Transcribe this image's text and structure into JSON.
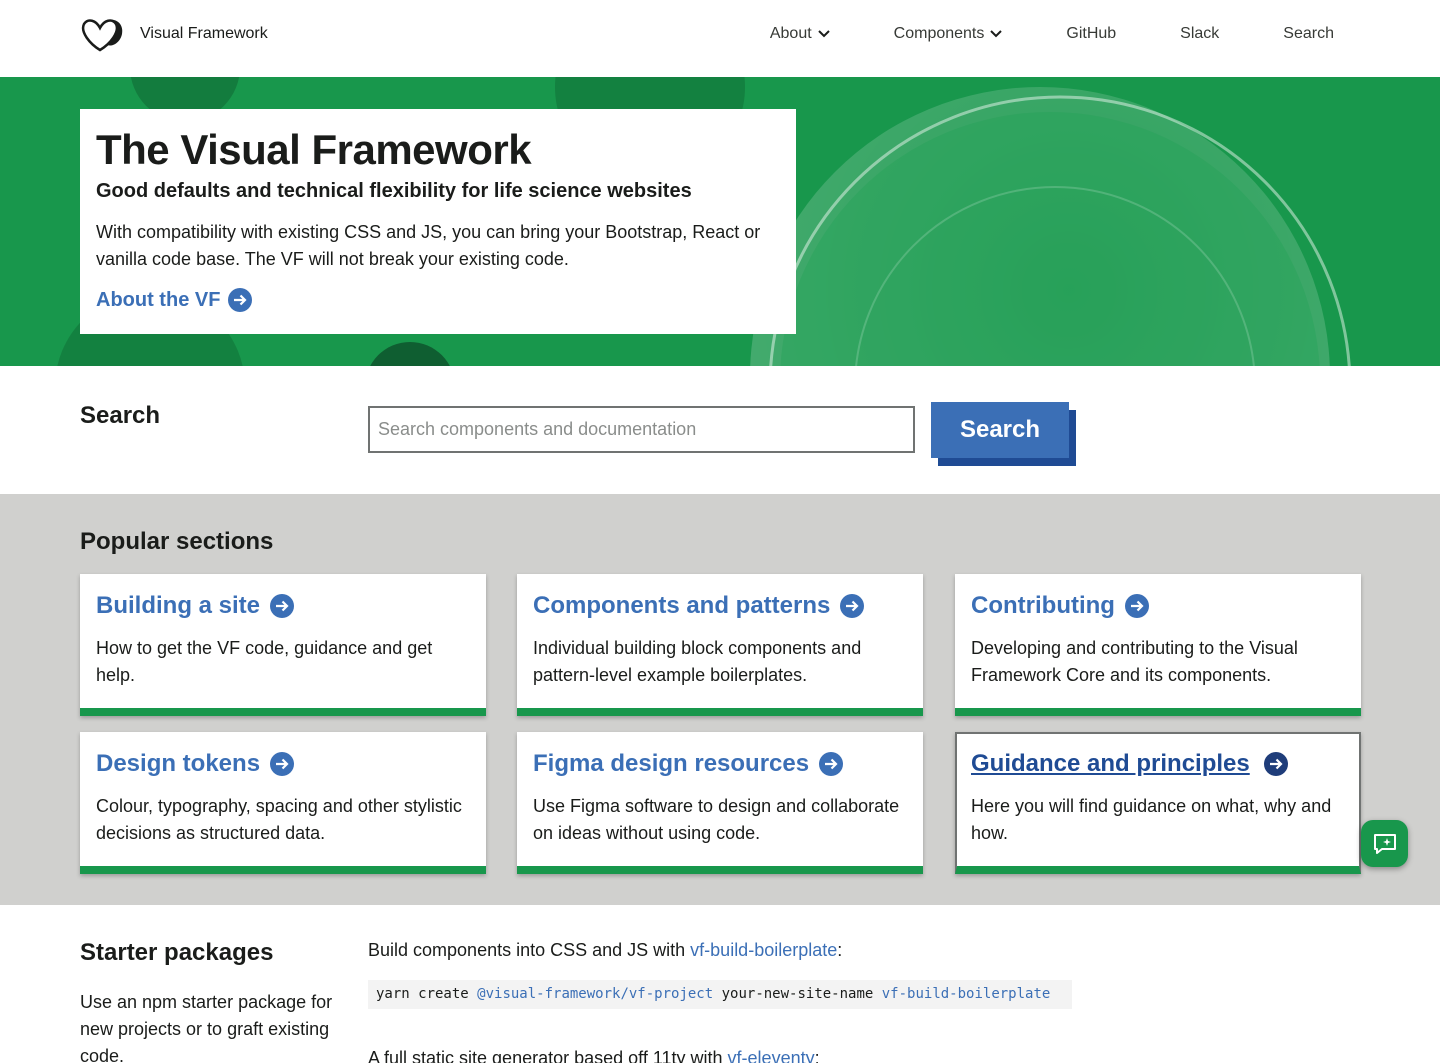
{
  "header": {
    "brand_name": "Visual Framework",
    "nav": [
      {
        "label": "About",
        "has_dropdown": true
      },
      {
        "label": "Components",
        "has_dropdown": true
      },
      {
        "label": "GitHub",
        "has_dropdown": false
      },
      {
        "label": "Slack",
        "has_dropdown": false
      },
      {
        "label": "Search",
        "has_dropdown": false
      }
    ]
  },
  "hero": {
    "title": "The Visual Framework",
    "subtitle": "Good defaults and technical flexibility for life science websites",
    "text": "With compatibility with existing CSS and JS, you can bring your Bootstrap, React or vanilla code base. The VF will not break your existing code.",
    "link_label": "About the VF"
  },
  "search": {
    "heading": "Search",
    "placeholder": "Search components and documentation",
    "button_label": "Search"
  },
  "popular": {
    "heading": "Popular sections",
    "cards": [
      {
        "title": "Building a site",
        "text": "How to get the VF code, guidance and get help."
      },
      {
        "title": "Components and patterns",
        "text": "Individual building block components and pattern-level example boilerplates."
      },
      {
        "title": "Contributing",
        "text": "Developing and contributing to the Visual Framework Core and its components."
      },
      {
        "title": "Design tokens",
        "text": "Colour, typography, spacing and other stylistic decisions as structured data."
      },
      {
        "title": "Figma design resources",
        "text": "Use Figma software to design and collaborate on ideas without using code."
      },
      {
        "title": "Guidance and principles",
        "text": "Here you will find guidance on what, why and how."
      }
    ]
  },
  "starter": {
    "heading": "Starter packages",
    "description": "Use an npm starter package for new projects or to graft existing code.",
    "line1_prefix": "Build components into CSS and JS with ",
    "line1_link": "vf-build-boilerplate",
    "line1_suffix": ":",
    "code": {
      "cmd": "yarn create ",
      "pkg": "@visual-framework/vf-project",
      "arg": " your-new-site-name ",
      "template": "vf-build-boilerplate"
    },
    "line2_prefix": "A full static site generator based off 11ty with ",
    "line2_link": "vf-eleventy",
    "line2_suffix": ":"
  },
  "colors": {
    "brand_green": "#18974c",
    "link_blue": "#3b6fb6",
    "button_shadow": "#1f4b94",
    "section_grey": "#d0d0ce"
  },
  "icons": [
    "vf-logo-icon",
    "chevron-down-icon",
    "arrow-right-circle-icon",
    "chat-sparkle-icon"
  ]
}
